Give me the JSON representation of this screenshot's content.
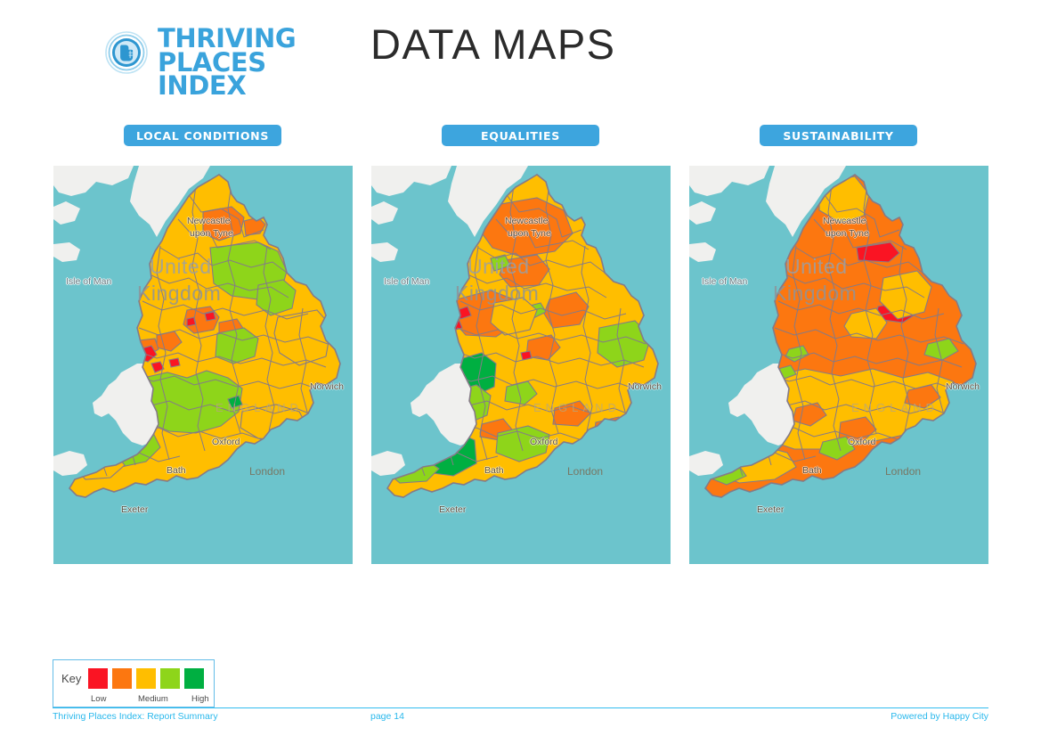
{
  "brand": {
    "logo_line1": "THRIVING",
    "logo_line2": "PLACES",
    "logo_line3": "INDEX",
    "logo_icon": "circular-badge-hand-building-icon",
    "brand_color": "#3AA3DC"
  },
  "header": {
    "title": "DATA MAPS"
  },
  "sections": [
    {
      "label": "LOCAL CONDITIONS",
      "pill_color": "#3DA5DE"
    },
    {
      "label": "EQUALITIES",
      "pill_color": "#3DA5DE"
    },
    {
      "label": "SUSTAINABILITY",
      "pill_color": "#3DA5DE"
    }
  ],
  "map_labels": {
    "isle_of_man": "Isle of Man",
    "united": "United",
    "kingdom": "Kingdom",
    "newcastle_line1": "Newcastle",
    "newcastle_line2": "upon Tyne",
    "england": "ENGLAND",
    "norwich": "Norwich",
    "oxford": "Oxford",
    "london": "London",
    "exeter": "Exeter",
    "bath": "Bath"
  },
  "map_style": {
    "sea": "#6CC4CC",
    "land_outside": "#F0F0EE",
    "border": "#857B87"
  },
  "key": {
    "title": "Key",
    "swatches": [
      {
        "name": "low",
        "color": "#FA1423"
      },
      {
        "name": "low-medium",
        "color": "#FC7710"
      },
      {
        "name": "medium",
        "color": "#FFBE00"
      },
      {
        "name": "medium-high",
        "color": "#8ED51A"
      },
      {
        "name": "high",
        "color": "#00AF41"
      }
    ],
    "tick_low": "Low",
    "tick_medium": "Medium",
    "tick_high": "High"
  },
  "footer": {
    "left": "Thriving Places Index: Report Summary",
    "center": "page 14",
    "right": "Powered by Happy City",
    "color": "#29B8EC"
  },
  "chart_data": {
    "type": "map",
    "title": "DATA MAPS",
    "description": "Three choropleth maps of England showing Thriving Places Index scores by local authority",
    "scale": {
      "type": "quintile",
      "labels": [
        "Low",
        "Medium",
        "High"
      ],
      "colors": [
        "#FA1423",
        "#FC7710",
        "#FFBE00",
        "#8ED51A",
        "#00AF41"
      ]
    },
    "panels": [
      {
        "name": "LOCAL CONDITIONS",
        "dominant_bands": [
          "medium",
          "medium-high"
        ],
        "notes": "North largely medium (amber) with medium-high (yellow-green) across Yorkshire and the South; scattered low (red) around Greater Manchester and Liverpool; one high (green) area near London."
      },
      {
        "name": "EQUALITIES",
        "dominant_bands": [
          "low-medium",
          "medium"
        ],
        "notes": "Strong orange (low-medium) band across the North West and North East; two distinct high (green) regions in mid-Wales border and Devon; medium-high in Norfolk and the far South West."
      },
      {
        "name": "SUSTAINABILITY",
        "dominant_bands": [
          "low-medium",
          "medium"
        ],
        "notes": "Predominantly orange (low-medium) across the North and Midlands with low (red) pockets near Tyneside and Humberside; amber across the South with isolated medium-high areas."
      }
    ]
  }
}
